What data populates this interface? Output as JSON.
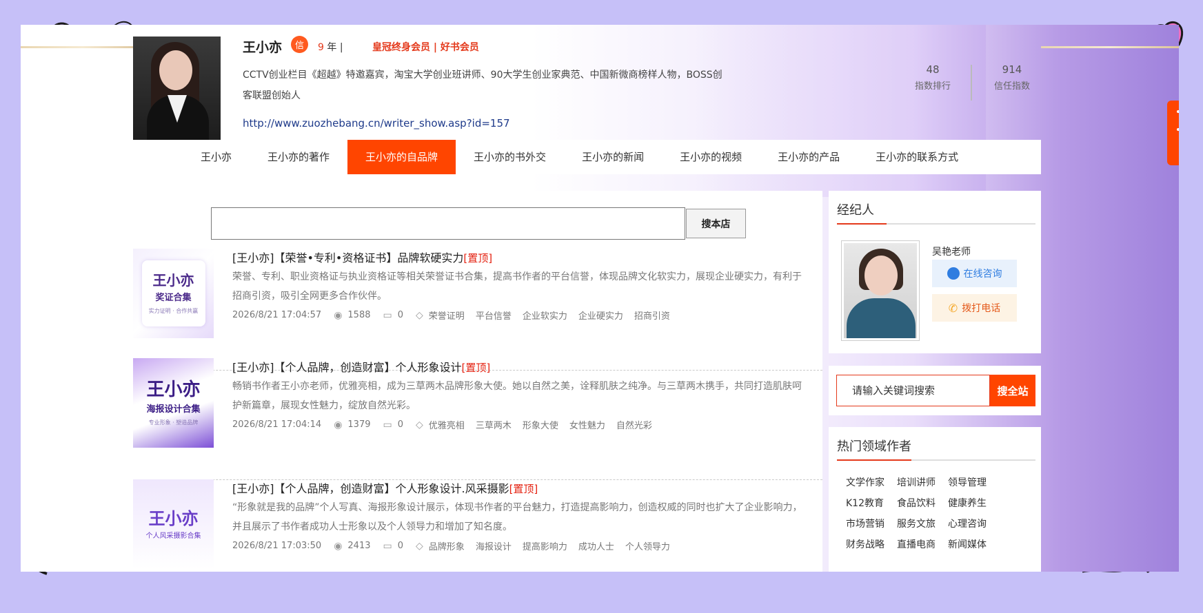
{
  "author": {
    "name": "王小亦",
    "badge": "信",
    "years_num": "9",
    "years_unit": "年 |",
    "membership": "皇冠终身会员 | 好书会员",
    "description": "CCTV创业栏目《超越》特邀嘉宾，淘宝大学创业班讲师、90大学生创业家典范、中国新微商榜样人物，BOSS创客联盟创始人",
    "url": "http://www.zuozhebang.cn/writer_show.asp?id=157"
  },
  "stats": [
    {
      "value": "48",
      "label": "指数排行"
    },
    {
      "value": "914",
      "label": "信任指数"
    }
  ],
  "nav": [
    {
      "label": "王小亦"
    },
    {
      "label": "王小亦的著作"
    },
    {
      "label": "王小亦的自品牌",
      "active": true
    },
    {
      "label": "王小亦的书外交"
    },
    {
      "label": "王小亦的新闻"
    },
    {
      "label": "王小亦的视频"
    },
    {
      "label": "王小亦的产品"
    },
    {
      "label": "王小亦的联系方式"
    }
  ],
  "search": {
    "value": "",
    "button": "搜本店"
  },
  "posts": [
    {
      "title": "[王小亦]【荣誉•专利•资格证书】品牌软硬实力",
      "pin": "[置顶]",
      "desc": "荣誉、专利、职业资格证与执业资格证等相关荣誉证书合集，提高书作者的平台信誉，体现品牌文化软实力，展现企业硬实力，有利于招商引资，吸引全网更多合作伙伴。",
      "date": "2026/8/21 17:04:57",
      "views": "1588",
      "comments": "0",
      "tags": [
        "荣誉证明",
        "平台信誉",
        "企业软实力",
        "企业硬实力",
        "招商引资"
      ],
      "thumb": {
        "big": "王小亦",
        "mid": "奖证合集",
        "small": "实力证明 · 合作共赢"
      }
    },
    {
      "title": "[王小亦]【个人品牌，创造财富】个人形象设计",
      "pin": "[置顶]",
      "desc": "畅销书作者王小亦老师，优雅亮相，成为三草两木品牌形象大使。她以自然之美，诠释肌肤之纯净。与三草两木携手，共同打造肌肤呵护新篇章，展现女性魅力，绽放自然光彩。",
      "date": "2026/8/21 17:04:14",
      "views": "1379",
      "comments": "0",
      "tags": [
        "优雅亮相",
        "三草两木",
        "形象大使",
        "女性魅力",
        "自然光彩"
      ],
      "thumb": {
        "big": "王小亦",
        "mid": "海报设计合集",
        "small": "专业形象 · 塑造品牌"
      }
    },
    {
      "title": "[王小亦]【个人品牌，创造财富】个人形象设计.风采摄影",
      "pin": "[置顶]",
      "desc": "“形象就是我的品牌”个人写真、海报形象设计展示，体现书作者的平台魅力，打造提高影响力，创造权威的同时也扩大了企业影响力，并且展示了书作者成功人士形象以及个人领导力和增加了知名度。",
      "date": "2026/8/21 17:03:50",
      "views": "2413",
      "comments": "0",
      "tags": [
        "品牌形象",
        "海报设计",
        "提高影响力",
        "成功人士",
        "个人领导力"
      ],
      "thumb": {
        "big": "王小亦",
        "mid": "个人风采摄影合集",
        "small": ""
      }
    }
  ],
  "agent": {
    "title": "经纪人",
    "name": "吴艳老师",
    "consult": "在线咨询",
    "call": "拨打电话"
  },
  "site_search": {
    "placeholder": "请输入关键词搜索",
    "button": "搜全站"
  },
  "hot": {
    "title": "热门领域作者",
    "items": [
      "文学作家",
      "培训讲师",
      "领导管理",
      "K12教育",
      "食品饮料",
      "健康养生",
      "市场营销",
      "服务文旅",
      "心理咨询",
      "财务战略",
      "直播电商",
      "新闻媒体"
    ]
  },
  "colors": {
    "accent": "#ff4500",
    "pin": "#e4200f",
    "link": "#1e3a8a",
    "page_bg": "#c6c0f8"
  }
}
